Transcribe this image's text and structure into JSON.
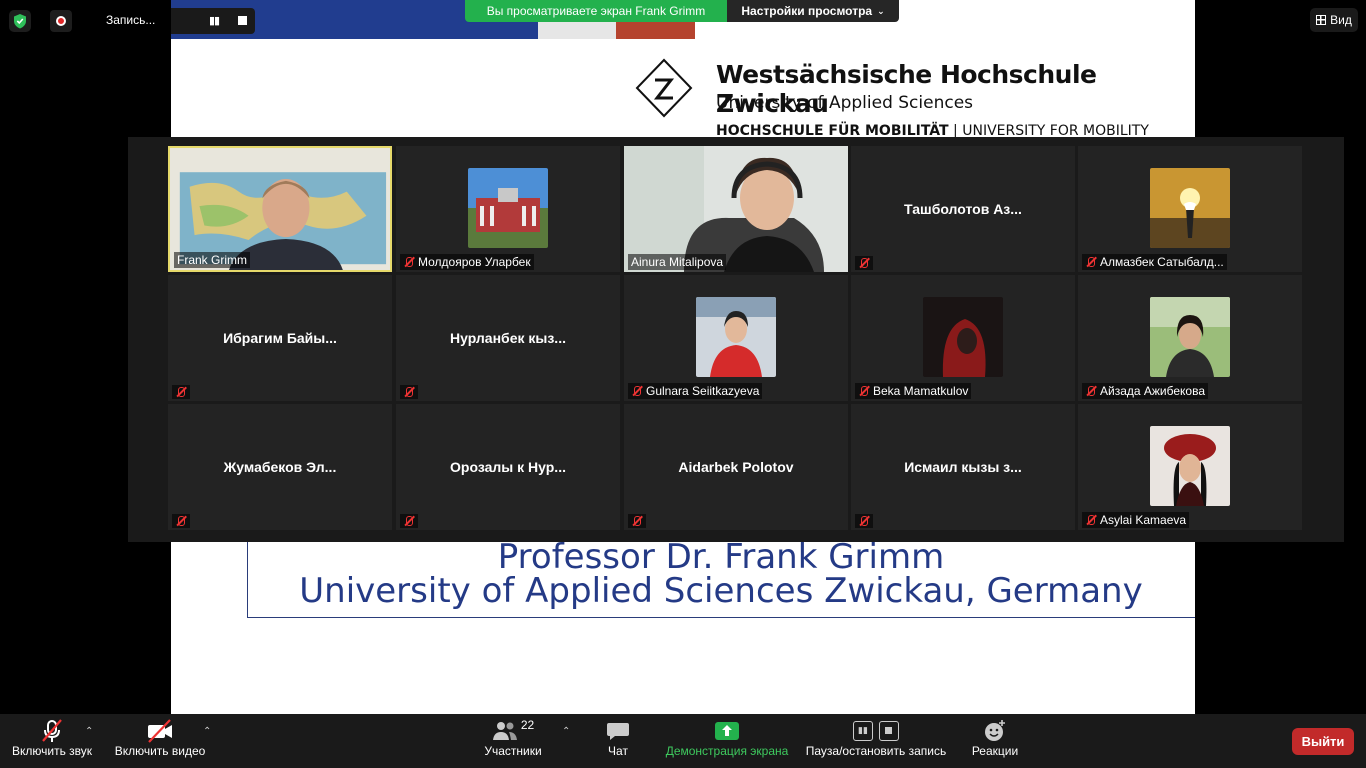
{
  "topbar": {
    "recording_label": "Запись...",
    "share_banner": "Вы просматриваете экран Frank Grimm",
    "view_options": "Настройки просмотра",
    "view_button": "Вид"
  },
  "slide": {
    "logo_title": "Westsächsische Hochschule Zwickau",
    "logo_subtitle": "University of Applied Sciences",
    "logo_mobility_bold": "HOCHSCHULE FÜR MOBILITÄT",
    "logo_mobility_rest": " | UNIVERSITY FOR MOBILITY",
    "presenter_line1": "Professor Dr. Frank Grimm",
    "presenter_line2": "University of Applied Sciences Zwickau, Germany"
  },
  "participants": [
    {
      "label": "Frank Grimm",
      "center": "",
      "muted": false,
      "active": true
    },
    {
      "label": "Молдояров Уларбек",
      "center": "",
      "muted": true
    },
    {
      "label": "Ainura Mitalipova",
      "center": "",
      "muted": false
    },
    {
      "label": "",
      "center": "Ташболотов Аз...",
      "muted": true
    },
    {
      "label": "Алмазбек Сатыбалд...",
      "center": "",
      "muted": true
    },
    {
      "label": "",
      "center": "Ибрагим Байы...",
      "muted": true
    },
    {
      "label": "",
      "center": "Нурланбек кыз...",
      "muted": true
    },
    {
      "label": "Gulnara Seiitkazyeva",
      "center": "",
      "muted": true
    },
    {
      "label": "Beka Mamatkulov",
      "center": "",
      "muted": true
    },
    {
      "label": "Айзада Ажибекова",
      "center": "",
      "muted": true
    },
    {
      "label": "",
      "center": "Жумабеков Эл...",
      "muted": true
    },
    {
      "label": "",
      "center": "Орозалы к Нур...",
      "muted": true
    },
    {
      "label": "",
      "center": "Aidarbek Polotov",
      "muted": true
    },
    {
      "label": "",
      "center": "Исмаил кызы з...",
      "muted": true
    },
    {
      "label": "Asylai Kamaeva",
      "center": "",
      "muted": true
    }
  ],
  "toolbar": {
    "unmute": "Включить звук",
    "start_video": "Включить видео",
    "participants": "Участники",
    "participants_count": "22",
    "chat": "Чат",
    "share_screen": "Демонстрация экрана",
    "pause_recording": "Пауза/остановить запись",
    "reactions": "Реакции",
    "leave": "Выйти"
  },
  "colors": {
    "share_green": "#23b14d",
    "leave_red": "#c22a2a",
    "active_speaker": "#e6d96a",
    "slide_navy": "#243a86"
  }
}
